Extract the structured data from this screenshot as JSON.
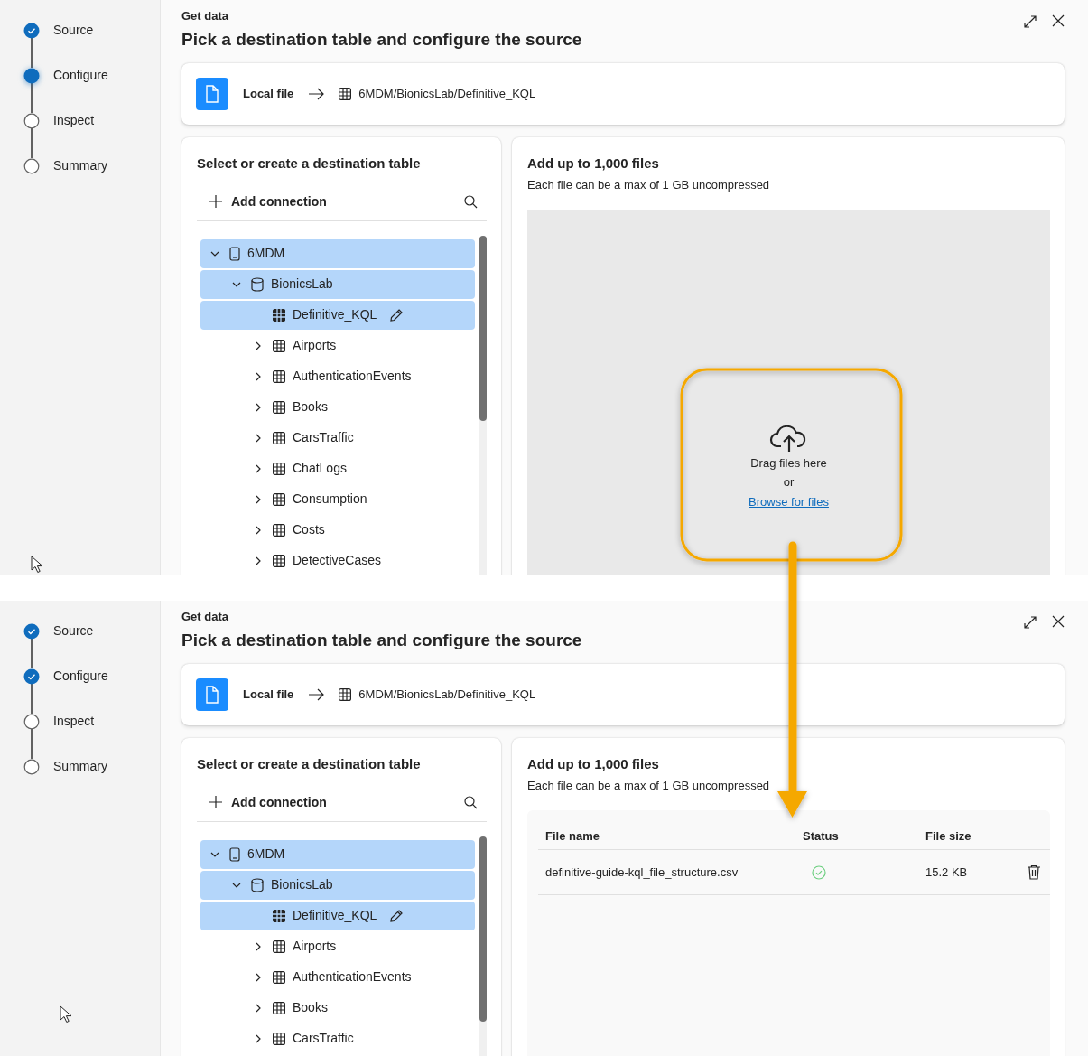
{
  "screens": [
    {
      "steps": [
        {
          "label": "Source",
          "completed": true,
          "selected": false
        },
        {
          "label": "Configure",
          "completed": false,
          "selected": true
        },
        {
          "label": "Inspect",
          "completed": false,
          "selected": false
        },
        {
          "label": "Summary",
          "completed": false,
          "selected": false
        }
      ],
      "eyebrow": "Get data",
      "title": "Pick a destination table and configure the source",
      "source": {
        "label": "Local file",
        "destination": "6MDM/BionicsLab/Definitive_KQL"
      },
      "tree_panel": {
        "title": "Select or create a destination table",
        "add_connection": "Add connection",
        "items": [
          {
            "label": "6MDM",
            "kind": "cluster",
            "expanded": true,
            "selected": true,
            "children": [
              {
                "label": "BionicsLab",
                "kind": "database",
                "expanded": true,
                "selected": true,
                "children": [
                  {
                    "label": "Definitive_KQL",
                    "kind": "table",
                    "selected": true
                  },
                  {
                    "label": "Airports",
                    "kind": "table",
                    "expanded": false,
                    "selected": false
                  },
                  {
                    "label": "AuthenticationEvents",
                    "kind": "table",
                    "expanded": false,
                    "selected": false
                  },
                  {
                    "label": "Books",
                    "kind": "table",
                    "expanded": false,
                    "selected": false
                  },
                  {
                    "label": "CarsTraffic",
                    "kind": "table",
                    "expanded": false,
                    "selected": false
                  },
                  {
                    "label": "ChatLogs",
                    "kind": "table",
                    "expanded": false,
                    "selected": false
                  },
                  {
                    "label": "Consumption",
                    "kind": "table",
                    "expanded": false,
                    "selected": false
                  },
                  {
                    "label": "Costs",
                    "kind": "table",
                    "expanded": false,
                    "selected": false
                  },
                  {
                    "label": "DetectiveCases",
                    "kind": "table",
                    "expanded": false,
                    "selected": false
                  }
                ]
              }
            ]
          }
        ]
      },
      "files_panel": {
        "title": "Add up to 1,000 files",
        "subtitle": "Each file can be a max of 1 GB uncompressed",
        "kind": "dropzone",
        "dropzone": {
          "text": "Drag files here",
          "separator": "or",
          "link": "Browse for files"
        }
      },
      "pointer_visible": true
    },
    {
      "steps": [
        {
          "label": "Source",
          "completed": true,
          "selected": false
        },
        {
          "label": "Configure",
          "completed": true,
          "selected": false
        },
        {
          "label": "Inspect",
          "completed": false,
          "selected": false
        },
        {
          "label": "Summary",
          "completed": false,
          "selected": false
        }
      ],
      "eyebrow": "Get data",
      "title": "Pick a destination table and configure the source",
      "source": {
        "label": "Local file",
        "destination": "6MDM/BionicsLab/Definitive_KQL"
      },
      "tree_panel": {
        "title": "Select or create a destination table",
        "add_connection": "Add connection",
        "items": [
          {
            "label": "6MDM",
            "kind": "cluster",
            "expanded": true,
            "selected": true,
            "children": [
              {
                "label": "BionicsLab",
                "kind": "database",
                "expanded": true,
                "selected": true,
                "children": [
                  {
                    "label": "Definitive_KQL",
                    "kind": "table",
                    "selected": true
                  },
                  {
                    "label": "Airports",
                    "kind": "table",
                    "expanded": false,
                    "selected": false
                  },
                  {
                    "label": "AuthenticationEvents",
                    "kind": "table",
                    "expanded": false,
                    "selected": false
                  },
                  {
                    "label": "Books",
                    "kind": "table",
                    "expanded": false,
                    "selected": false
                  },
                  {
                    "label": "CarsTraffic",
                    "kind": "table",
                    "expanded": false,
                    "selected": false
                  }
                ]
              }
            ]
          }
        ]
      },
      "files_panel": {
        "title": "Add up to 1,000 files",
        "subtitle": "Each file can be a max of 1 GB uncompressed",
        "kind": "table",
        "table": {
          "columns": [
            "File name",
            "Status",
            "File size"
          ],
          "rows": [
            {
              "file_name": "definitive-guide-kql_file_structure.csv",
              "succeeded": true,
              "file_size": "15.2 KB"
            }
          ]
        }
      },
      "pointer_visible": true
    }
  ]
}
